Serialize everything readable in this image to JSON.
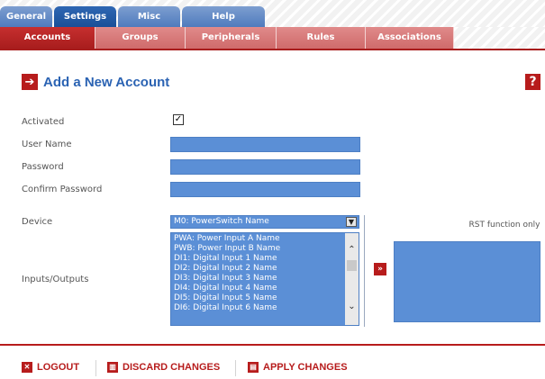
{
  "top_tabs": [
    {
      "label": "General",
      "active": false
    },
    {
      "label": "Settings",
      "active": true
    },
    {
      "label": "Misc",
      "active": false
    },
    {
      "label": "Help",
      "active": false
    }
  ],
  "sub_tabs": [
    {
      "label": "Accounts",
      "active": true
    },
    {
      "label": "Groups",
      "active": false
    },
    {
      "label": "Peripherals",
      "active": false
    },
    {
      "label": "Rules",
      "active": false
    },
    {
      "label": "Associations",
      "active": false
    }
  ],
  "header": {
    "title": "Add a New Account",
    "title_icon": "arrow-right-icon",
    "help_icon": "help-icon"
  },
  "form": {
    "activated_label": "Activated",
    "activated_checked": "✓",
    "username_label": "User Name",
    "password_label": "Password",
    "confirm_label": "Confirm Password",
    "device_label": "Device",
    "device_value": "M0: PowerSwitch Name",
    "io_label": "Inputs/Outputs",
    "io_items": [
      "PWA: Power Input A Name",
      "PWB: Power Input B Name",
      "DI1: Digital Input 1 Name",
      "DI2: Digital Input 2 Name",
      "DI3: Digital Input 3 Name",
      "DI4: Digital Input 4 Name",
      "DI5: Digital Input 5 Name",
      "DI6: Digital Input 6 Name"
    ],
    "rst_label": "RST function only"
  },
  "footer": {
    "logout": "LOGOUT",
    "discard": "DISCARD CHANGES",
    "apply": "APPLY CHANGES"
  },
  "colors": {
    "brand_red": "#b71c1c",
    "brand_blue": "#2b63b3",
    "field_blue": "#5b8fd6"
  }
}
